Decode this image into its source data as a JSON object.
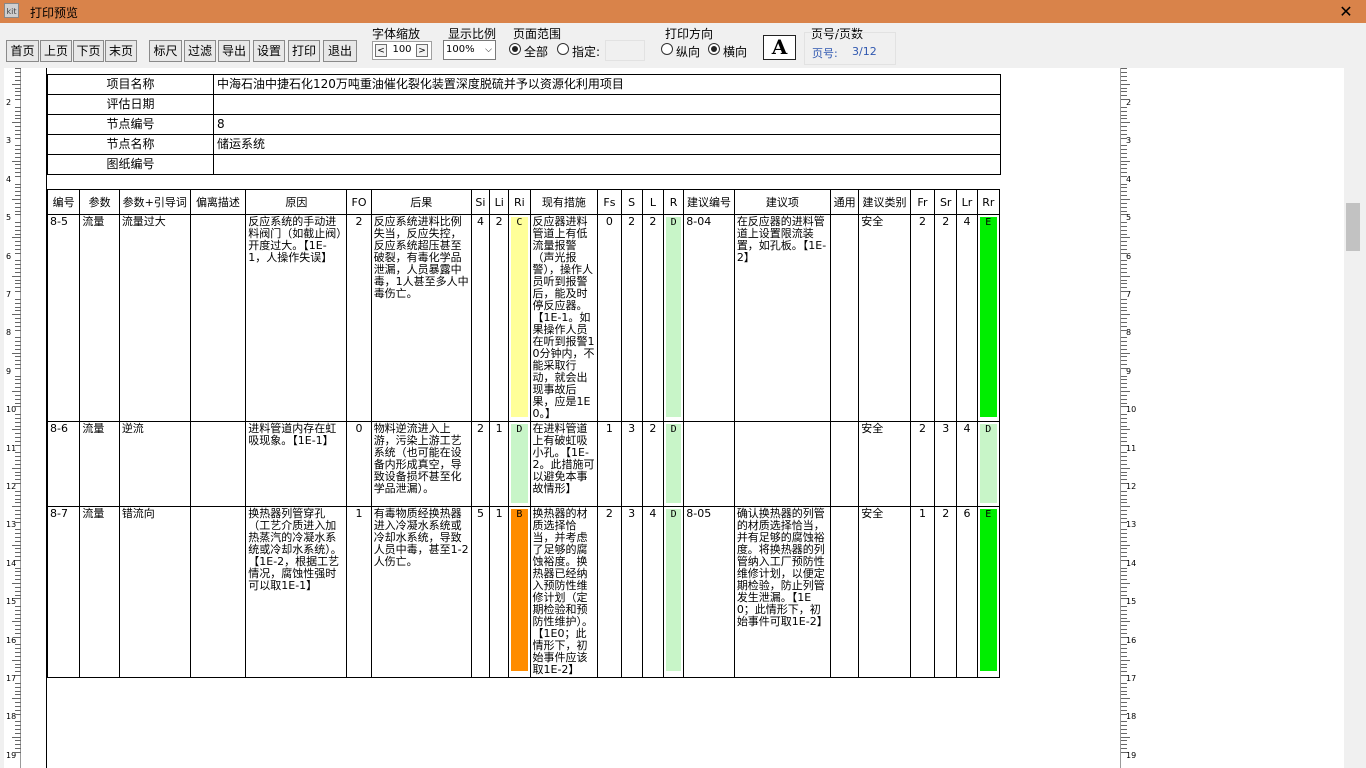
{
  "window": {
    "title": "打印预览",
    "icon_label": "kit",
    "close_glyph": "✕"
  },
  "toolbar": {
    "nav_buttons": [
      "首页",
      "上页",
      "下页",
      "末页"
    ],
    "func_buttons": [
      "标尺",
      "过滤",
      "导出",
      "设置",
      "打印",
      "退出"
    ],
    "font_zoom": {
      "label": "字体缩放",
      "value": "100",
      "dec": "<",
      "inc": ">"
    },
    "display_ratio": {
      "label": "显示比例",
      "value": "100%"
    },
    "page_range": {
      "label": "页面范围",
      "all": "全部",
      "specify": "指定:",
      "selected": "all"
    },
    "orientation": {
      "label": "打印方向",
      "portrait": "纵向",
      "landscape": "横向",
      "selected": "landscape"
    },
    "font_button": "A",
    "page_info": {
      "label": "页号/页数",
      "page_label": "页号:",
      "page_value": "3/12"
    }
  },
  "rulers": {
    "left_numbers": [
      "2",
      "3",
      "4",
      "5",
      "6",
      "7",
      "8",
      "9",
      "10",
      "11",
      "12",
      "13",
      "14",
      "15",
      "16",
      "17",
      "18",
      "19"
    ]
  },
  "info_table": [
    {
      "key": "项目名称",
      "value": "中海石油中捷石化120万吨重油催化裂化装置深度脱硫并予以资源化利用项目"
    },
    {
      "key": "评估日期",
      "value": ""
    },
    {
      "key": "节点编号",
      "value": "8"
    },
    {
      "key": "节点名称",
      "value": "储运系统"
    },
    {
      "key": "图纸编号",
      "value": ""
    }
  ],
  "main_table": {
    "headers": [
      "编号",
      "参数",
      "参数+引导词",
      "偏离描述",
      "原因",
      "FO",
      "后果",
      "Si",
      "Li",
      "Ri",
      "现有措施",
      "Fs",
      "S",
      "L",
      "R",
      "建议编号",
      "建议项",
      "通用",
      "建议类别",
      "Fr",
      "Sr",
      "Lr",
      "Rr"
    ],
    "rows": [
      {
        "id": "8-5",
        "param": "流量",
        "guide": "流量过大",
        "deviation": "",
        "cause": "反应系统的手动进料阀门（如截止阀）开度过大。【1E-1，人操作失误】",
        "fo": "2",
        "consequence": "反应系统进料比例失当，反应失控，反应系统超压甚至破裂，有毒化学品泄漏，人员暴露中毒，1人甚至多人中毒伤亡。",
        "si": "4",
        "li": "2",
        "ri": "C",
        "measure": "反应器进料管道上有低流量报警（声光报警），操作人员听到报警后，能及时停反应器。【1E-1。如果操作人员在听到报警10分钟内，不能采取行动，就会出现事故后果，应是1E0。】",
        "fs": "0",
        "s": "2",
        "l": "2",
        "r": "D",
        "sugg_id": "8-04",
        "suggestion": "在反应器的进料管道上设置限流装置，如孔板。【1E-2】",
        "general": "",
        "category": "安全",
        "fr": "2",
        "sr": "2",
        "lr": "4",
        "rr": "E"
      },
      {
        "id": "8-6",
        "param": "流量",
        "guide": "逆流",
        "deviation": "",
        "cause": "进料管道内存在虹吸现象。【1E-1】",
        "fo": "0",
        "consequence": "物料逆流进入上游，污染上游工艺系统（也可能在设备内形成真空，导致设备损坏甚至化学品泄漏）。",
        "si": "2",
        "li": "1",
        "ri": "D",
        "measure": "在进料管道上有破虹吸小孔。【1E-2。此措施可以避免本事故情形】",
        "fs": "1",
        "s": "3",
        "l": "2",
        "r": "D",
        "sugg_id": "",
        "suggestion": "",
        "general": "",
        "category": "安全",
        "fr": "2",
        "sr": "3",
        "lr": "4",
        "rr": "D"
      },
      {
        "id": "8-7",
        "param": "流量",
        "guide": "错流向",
        "deviation": "",
        "cause": "换热器列管穿孔（工艺介质进入加热蒸汽的冷凝水系统或冷却水系统）。【1E-2，根据工艺情况，腐蚀性强时可以取1E-1】",
        "fo": "1",
        "consequence": "有毒物质经换热器进入冷凝水系统或冷却水系统，导致人员中毒，甚至1-2人伤亡。",
        "si": "5",
        "li": "1",
        "ri": "B",
        "measure": "换热器的材质选择恰当，并考虑了足够的腐蚀裕度。换热器已经纳入预防性维修计划（定期检验和预防性维护）。【1E0；此情形下，初始事件应该取1E-2】",
        "fs": "2",
        "s": "3",
        "l": "4",
        "r": "D",
        "sugg_id": "8-05",
        "suggestion": "确认换热器的列管的材质选择恰当，并有足够的腐蚀裕度。将换热器的列管纳入工厂预防性维修计划，以便定期检验，防止列管发生泄漏。【1E0；此情形下，初始事件可取1E-2】",
        "general": "",
        "category": "安全",
        "fr": "1",
        "sr": "2",
        "lr": "6",
        "rr": "E"
      }
    ]
  },
  "risk_colors": {
    "A": "#ff3b3b",
    "B": "#ff8c00",
    "C": "#ffff99",
    "D": "#c8f5c8",
    "E": "#00ee00"
  }
}
